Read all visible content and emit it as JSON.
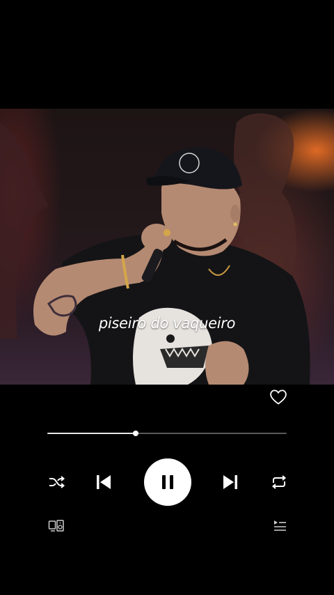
{
  "video": {
    "caption": "piseiro do vaqueiro"
  },
  "player": {
    "progress_fraction": 0.37,
    "elapsed_time": "",
    "remaining_time": "",
    "liked": false,
    "is_playing": true
  },
  "colors": {
    "background": "#000000",
    "track": "#5a5a5a",
    "fill": "#e8e8e8",
    "icon": "#ffffff"
  },
  "icons": {
    "like": "heart-outline-icon",
    "shuffle": "shuffle-icon",
    "previous": "skip-previous-icon",
    "play_pause": "pause-icon",
    "next": "skip-next-icon",
    "repeat": "repeat-icon",
    "devices": "connect-devices-icon",
    "queue": "queue-icon"
  }
}
